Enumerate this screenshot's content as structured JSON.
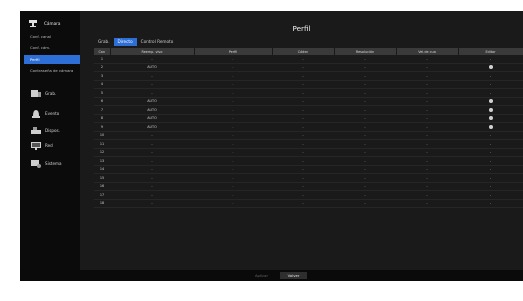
{
  "sidebar": {
    "header": {
      "label": "Cámara",
      "icon": "camera-icon"
    },
    "items": [
      {
        "label": "Conf. canal",
        "active": false
      },
      {
        "label": "Conf. cám.",
        "active": false
      },
      {
        "label": "Perfil",
        "active": true
      },
      {
        "label": "Contraseña de cámara",
        "active": false
      }
    ],
    "menus": [
      {
        "label": "Grab.",
        "icon": "record-icon"
      },
      {
        "label": "Evento",
        "icon": "event-icon"
      },
      {
        "label": "Dispos.",
        "icon": "device-icon"
      },
      {
        "label": "Red",
        "icon": "network-icon"
      },
      {
        "label": "Sistema",
        "icon": "system-icon"
      }
    ]
  },
  "main": {
    "title": "Perfil",
    "tabs": [
      {
        "label": "Grab.",
        "active": false
      },
      {
        "label": "Directo",
        "active": true
      },
      {
        "label": "Control Remoto",
        "active": false
      }
    ],
    "columns": [
      "Can",
      "Reemp. vivo",
      "Perfil",
      "Códec",
      "Resolución",
      "Vel.de cua",
      "Editar"
    ],
    "rows": [
      {
        "can": "1",
        "reemp": "-",
        "perfil": "-",
        "codec": "-",
        "res": "-",
        "vel": "-",
        "editar": "-"
      },
      {
        "can": "2",
        "reemp": "AUTO",
        "perfil": "-",
        "codec": "-",
        "res": "-",
        "vel": "-",
        "editar": "gear"
      },
      {
        "can": "3",
        "reemp": "-",
        "perfil": "-",
        "codec": "-",
        "res": "-",
        "vel": "-",
        "editar": "-"
      },
      {
        "can": "4",
        "reemp": "-",
        "perfil": "-",
        "codec": "-",
        "res": "-",
        "vel": "-",
        "editar": "-"
      },
      {
        "can": "5",
        "reemp": "-",
        "perfil": "-",
        "codec": "-",
        "res": "-",
        "vel": "-",
        "editar": "-"
      },
      {
        "can": "6",
        "reemp": "AUTO",
        "perfil": "-",
        "codec": "-",
        "res": "-",
        "vel": "-",
        "editar": "gear"
      },
      {
        "can": "7",
        "reemp": "AUTO",
        "perfil": "-",
        "codec": "-",
        "res": "-",
        "vel": "-",
        "editar": "gear"
      },
      {
        "can": "8",
        "reemp": "AUTO",
        "perfil": "-",
        "codec": "-",
        "res": "-",
        "vel": "-",
        "editar": "gear"
      },
      {
        "can": "9",
        "reemp": "AUTO",
        "perfil": "-",
        "codec": "-",
        "res": "-",
        "vel": "-",
        "editar": "gear"
      },
      {
        "can": "10",
        "reemp": "-",
        "perfil": "-",
        "codec": "-",
        "res": "-",
        "vel": "-",
        "editar": "-"
      },
      {
        "can": "11",
        "reemp": "-",
        "perfil": "-",
        "codec": "-",
        "res": "-",
        "vel": "-",
        "editar": "-"
      },
      {
        "can": "12",
        "reemp": "-",
        "perfil": "-",
        "codec": "-",
        "res": "-",
        "vel": "-",
        "editar": "-"
      },
      {
        "can": "13",
        "reemp": "-",
        "perfil": "-",
        "codec": "-",
        "res": "-",
        "vel": "-",
        "editar": "-"
      },
      {
        "can": "14",
        "reemp": "-",
        "perfil": "-",
        "codec": "-",
        "res": "-",
        "vel": "-",
        "editar": "-"
      },
      {
        "can": "15",
        "reemp": "-",
        "perfil": "-",
        "codec": "-",
        "res": "-",
        "vel": "-",
        "editar": "-"
      },
      {
        "can": "16",
        "reemp": "-",
        "perfil": "-",
        "codec": "-",
        "res": "-",
        "vel": "-",
        "editar": "-"
      },
      {
        "can": "17",
        "reemp": "-",
        "perfil": "-",
        "codec": "-",
        "res": "-",
        "vel": "-",
        "editar": "-"
      },
      {
        "can": "18",
        "reemp": "-",
        "perfil": "-",
        "codec": "-",
        "res": "-",
        "vel": "-",
        "editar": "-"
      }
    ]
  },
  "footer": {
    "apply_label": "Aplicar",
    "back_label": "Volver"
  },
  "colors": {
    "accent": "#2d6fd6",
    "panel": "#1a1a1a",
    "sidebar": "#0b0b0b"
  }
}
